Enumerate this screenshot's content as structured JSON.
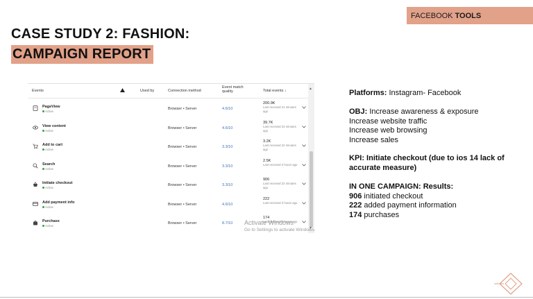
{
  "tag": {
    "normal": "FACEBOOK",
    "bold": "TOOLS"
  },
  "title": {
    "line1": "CASE STUDY 2: FASHION:",
    "line2": "CAMPAIGN REPORT"
  },
  "table": {
    "headers": {
      "events": "Events",
      "used_by": "Used by",
      "connection": "Connection method",
      "quality": "Event match quality",
      "total": "Total events ↓"
    },
    "rows": [
      {
        "name": "PageView",
        "status": "Active",
        "icon": "page-icon",
        "connection": "Browser • Server",
        "quality": "4.6/10",
        "total": "200.9K",
        "received": "Last received 21 minutes ago"
      },
      {
        "name": "View content",
        "status": "Active",
        "icon": "eye-icon",
        "connection": "Browser • Server",
        "quality": "4.6/10",
        "total": "39.7K",
        "received": "Last received 24 minutes ago"
      },
      {
        "name": "Add to cart",
        "status": "Active",
        "icon": "cart-icon",
        "connection": "Browser • Server",
        "quality": "3.3/10",
        "total": "3.2K",
        "received": "Last received 22 minutes ago"
      },
      {
        "name": "Search",
        "status": "Active",
        "icon": "search-icon",
        "connection": "Browser • Server",
        "quality": "3.3/10",
        "total": "2.5K",
        "received": "Last received 3 hours ago"
      },
      {
        "name": "Initiate checkout",
        "status": "Active",
        "icon": "basket-icon",
        "connection": "Browser • Server",
        "quality": "3.3/10",
        "total": "906",
        "received": "Last received 22 minutes ago"
      },
      {
        "name": "Add payment info",
        "status": "Active",
        "icon": "card-icon",
        "connection": "Browser • Server",
        "quality": "4.6/10",
        "total": "222",
        "received": "Last received 3 hours ago"
      },
      {
        "name": "Purchase",
        "status": "Active",
        "icon": "bag-icon",
        "connection": "Browser • Server",
        "quality": "8.7/10",
        "total": "174",
        "received": "Last received 3 hours ago"
      }
    ]
  },
  "watermark": {
    "line1": "Activate Windows",
    "line2": "Go to Settings to activate Windows."
  },
  "info": {
    "platforms_label": "Platforms:",
    "platforms_value": " Instagram- Facebook",
    "obj_label": "OBJ:",
    "obj_value": " Increase awareness & exposure",
    "obj_lines": [
      "Increase website traffic",
      "Increase web browsing",
      "Increase sales"
    ],
    "kpi_line1": "KPI: Initiate checkout (due to ios 14 lack of",
    "kpi_line2": "accurate measure)",
    "results_label": "IN ONE CAMPAIGN: Results:",
    "results": [
      {
        "num": "906",
        "text": " initiated checkout"
      },
      {
        "num": "222",
        "text": " added payment information"
      },
      {
        "num": "174",
        "text": " purchases"
      }
    ]
  },
  "colors": {
    "accent": "#e2a189",
    "quality_link": "#3b6fb6",
    "active_dot": "#3aa04a"
  }
}
